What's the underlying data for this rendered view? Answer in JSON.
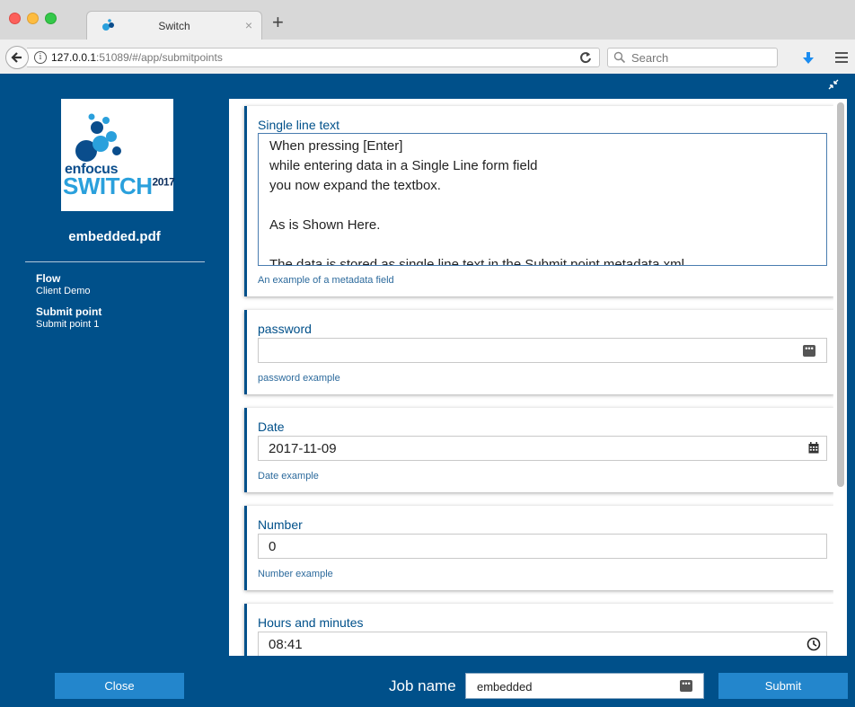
{
  "browser": {
    "tab_title": "Switch",
    "tab_close": "×",
    "new_tab": "+",
    "url_host": "127.0.0.1",
    "url_path": ":51089/#/app/submitpoints",
    "search_placeholder": "Search"
  },
  "sidebar": {
    "logo_enfocus": "enfocus",
    "logo_switch": "SWITCH",
    "logo_year": "2017",
    "filename": "embedded.pdf",
    "flow_label": "Flow",
    "flow_value": "Client Demo",
    "submit_point_label": "Submit point",
    "submit_point_value": "Submit point 1"
  },
  "fields": {
    "single_line": {
      "label": "Single line text",
      "lines": [
        "When pressing [Enter]",
        "while entering data in a Single Line form field",
        "you now expand the textbox.",
        "",
        "As is Shown Here.",
        "",
        "The data is stored as single line text in the Submit point metadata xml."
      ],
      "help": "An example of a metadata field"
    },
    "password": {
      "label": "password",
      "value": "",
      "help": "password example"
    },
    "date": {
      "label": "Date",
      "value": "2017-11-09",
      "help": "Date example"
    },
    "number": {
      "label": "Number",
      "value": "0",
      "help": "Number example"
    },
    "hours": {
      "label": "Hours and minutes",
      "value": "08:41"
    }
  },
  "footer": {
    "close_label": "Close",
    "job_name_label": "Job name",
    "job_name_value": "embedded",
    "submit_label": "Submit"
  },
  "colors": {
    "app_background": "#00508a",
    "button": "#2386cc",
    "accent_light": "#2aa0dc"
  }
}
